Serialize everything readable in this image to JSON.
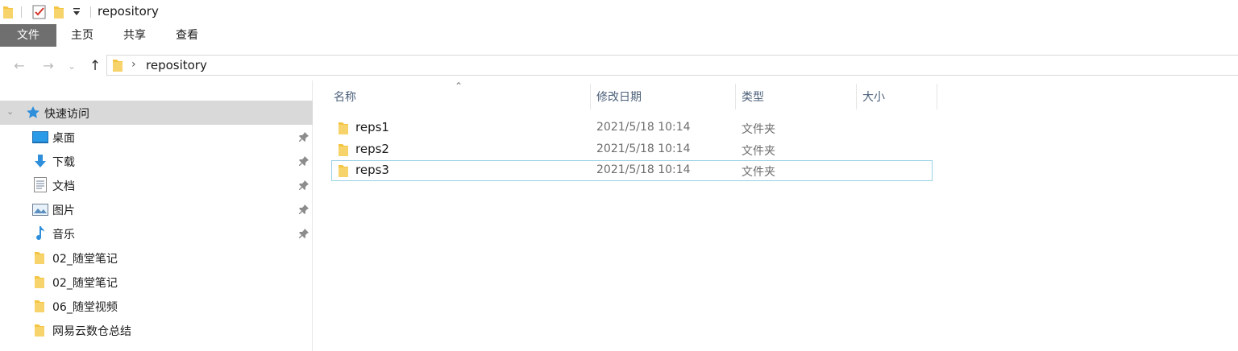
{
  "window": {
    "title": "repository"
  },
  "quick_access_toolbar": {
    "icons": [
      "folder-icon",
      "properties-check-icon",
      "new-folder-icon",
      "customize-dropdown-icon"
    ]
  },
  "ribbon": {
    "tabs": [
      "文件",
      "主页",
      "共享",
      "查看"
    ],
    "active_tab": "文件"
  },
  "navigation": {
    "back": "←",
    "forward": "→",
    "recent": "⌄",
    "up": "↑"
  },
  "address": {
    "path": [
      "repository"
    ]
  },
  "sidebar": {
    "quick_access": {
      "label": "快速访问",
      "expanded": true
    },
    "items": [
      {
        "label": "桌面",
        "icon": "desktop-icon",
        "pinned": true
      },
      {
        "label": "下载",
        "icon": "download-icon",
        "pinned": true
      },
      {
        "label": "文档",
        "icon": "document-icon",
        "pinned": true
      },
      {
        "label": "图片",
        "icon": "pictures-icon",
        "pinned": true
      },
      {
        "label": "音乐",
        "icon": "music-icon",
        "pinned": true
      },
      {
        "label": "02_随堂笔记",
        "icon": "folder-icon",
        "pinned": false
      },
      {
        "label": "02_随堂笔记",
        "icon": "folder-icon",
        "pinned": false
      },
      {
        "label": "06_随堂视频",
        "icon": "folder-icon",
        "pinned": false
      },
      {
        "label": "网易云数仓总结",
        "icon": "folder-icon",
        "pinned": false
      }
    ]
  },
  "file_list": {
    "columns": [
      "名称",
      "修改日期",
      "类型",
      "大小"
    ],
    "sort_column": "名称",
    "rows": [
      {
        "name": "reps1",
        "modified": "2021/5/18 10:14",
        "type": "文件夹",
        "size": ""
      },
      {
        "name": "reps2",
        "modified": "2021/5/18 10:14",
        "type": "文件夹",
        "size": ""
      },
      {
        "name": "reps3",
        "modified": "2021/5/18 10:14",
        "type": "文件夹",
        "size": ""
      }
    ],
    "focused_row": 2
  },
  "colors": {
    "folder": "#f4c542",
    "header_text": "#4c607a",
    "focus_border": "#99d1e6",
    "selected_bg": "#d9d9d9",
    "file_tab_bg": "#6f6f6f"
  }
}
